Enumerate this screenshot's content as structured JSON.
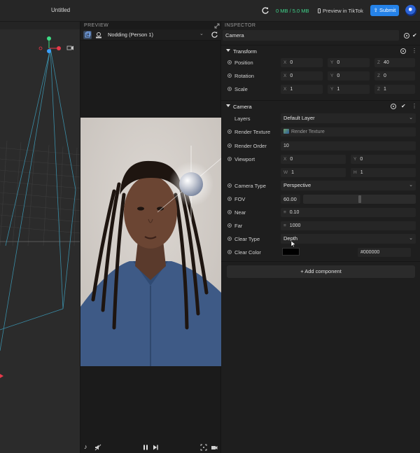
{
  "topbar": {
    "project_title": "Untitled",
    "memory": "0 MB / 5.0 MB",
    "preview_label": "Preview in TikTok",
    "submit_label": "Submit"
  },
  "preview": {
    "panel_label": "PREVIEW",
    "selected_clip": "Nodding (Person 1)"
  },
  "inspector": {
    "panel_label": "INSPECTOR",
    "object_name": "Camera",
    "transform": {
      "title": "Transform",
      "position": {
        "label": "Position",
        "x": "0",
        "y": "0",
        "z": "40"
      },
      "rotation": {
        "label": "Rotation",
        "x": "0",
        "y": "0",
        "z": "0"
      },
      "scale": {
        "label": "Scale",
        "x": "1",
        "y": "1",
        "z": "1"
      }
    },
    "camera": {
      "title": "Camera",
      "layers": {
        "label": "Layers",
        "value": "Default Layer"
      },
      "render_texture": {
        "label": "Render Texture",
        "value": "Render Texture"
      },
      "render_order": {
        "label": "Render Order",
        "value": "10"
      },
      "viewport": {
        "label": "Viewport",
        "x": "0",
        "y": "0",
        "w": "1",
        "h": "1"
      },
      "camera_type": {
        "label": "Camera Type",
        "value": "Perspective"
      },
      "fov": {
        "label": "FOV",
        "value": "60.00",
        "fraction": 0.5
      },
      "near": {
        "label": "Near",
        "value": "0.10"
      },
      "far": {
        "label": "Far",
        "value": "1000"
      },
      "clear_type": {
        "label": "Clear Type",
        "value": "Depth"
      },
      "clear_color": {
        "label": "Clear Color",
        "value": "#000000",
        "swatch": "#000000"
      }
    },
    "add_component_label": "+ Add component"
  },
  "axis_labels": {
    "x": "X",
    "y": "Y",
    "z": "Z",
    "w": "W",
    "h": "H"
  },
  "colors": {
    "accent": "#2582e8",
    "memory_text": "#3fd28a",
    "gizmo_x": "#e8394a",
    "gizmo_y": "#3ddc84",
    "gizmo_z": "#3aa0ff"
  }
}
